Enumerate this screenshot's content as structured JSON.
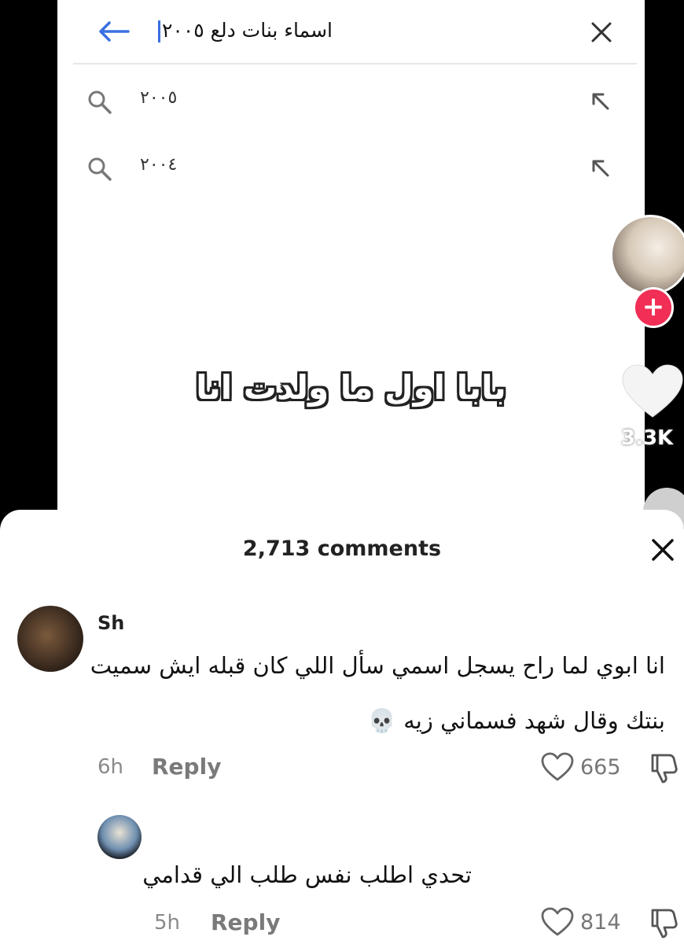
{
  "search": {
    "query": "اسماء بنات دلع ٢٠٠٥",
    "suggestions": [
      {
        "text": "٢٠٠٥"
      },
      {
        "text": "٢٠٠٤"
      }
    ]
  },
  "video": {
    "caption": "بابا اول ما ولدت انا",
    "like_count": "3.3K"
  },
  "comments": {
    "count_label": "2,713 comments",
    "items": [
      {
        "username": "Sh",
        "text_line1": "انا ابوي لما راح يسجل اسمي سأل اللي كان قبله ايش سميت",
        "text_line2": "بنتك وقال شهد فسماني زيه 💀",
        "time": "6h",
        "reply_label": "Reply",
        "likes": "665"
      },
      {
        "username": "",
        "text_line1": "تحدي اطلب نفس طلب الي قدامي",
        "time": "5h",
        "reply_label": "Reply",
        "likes": "814"
      }
    ]
  },
  "colors": {
    "follow_accent": "#f12e55",
    "back_arrow": "#3a6fe0"
  }
}
